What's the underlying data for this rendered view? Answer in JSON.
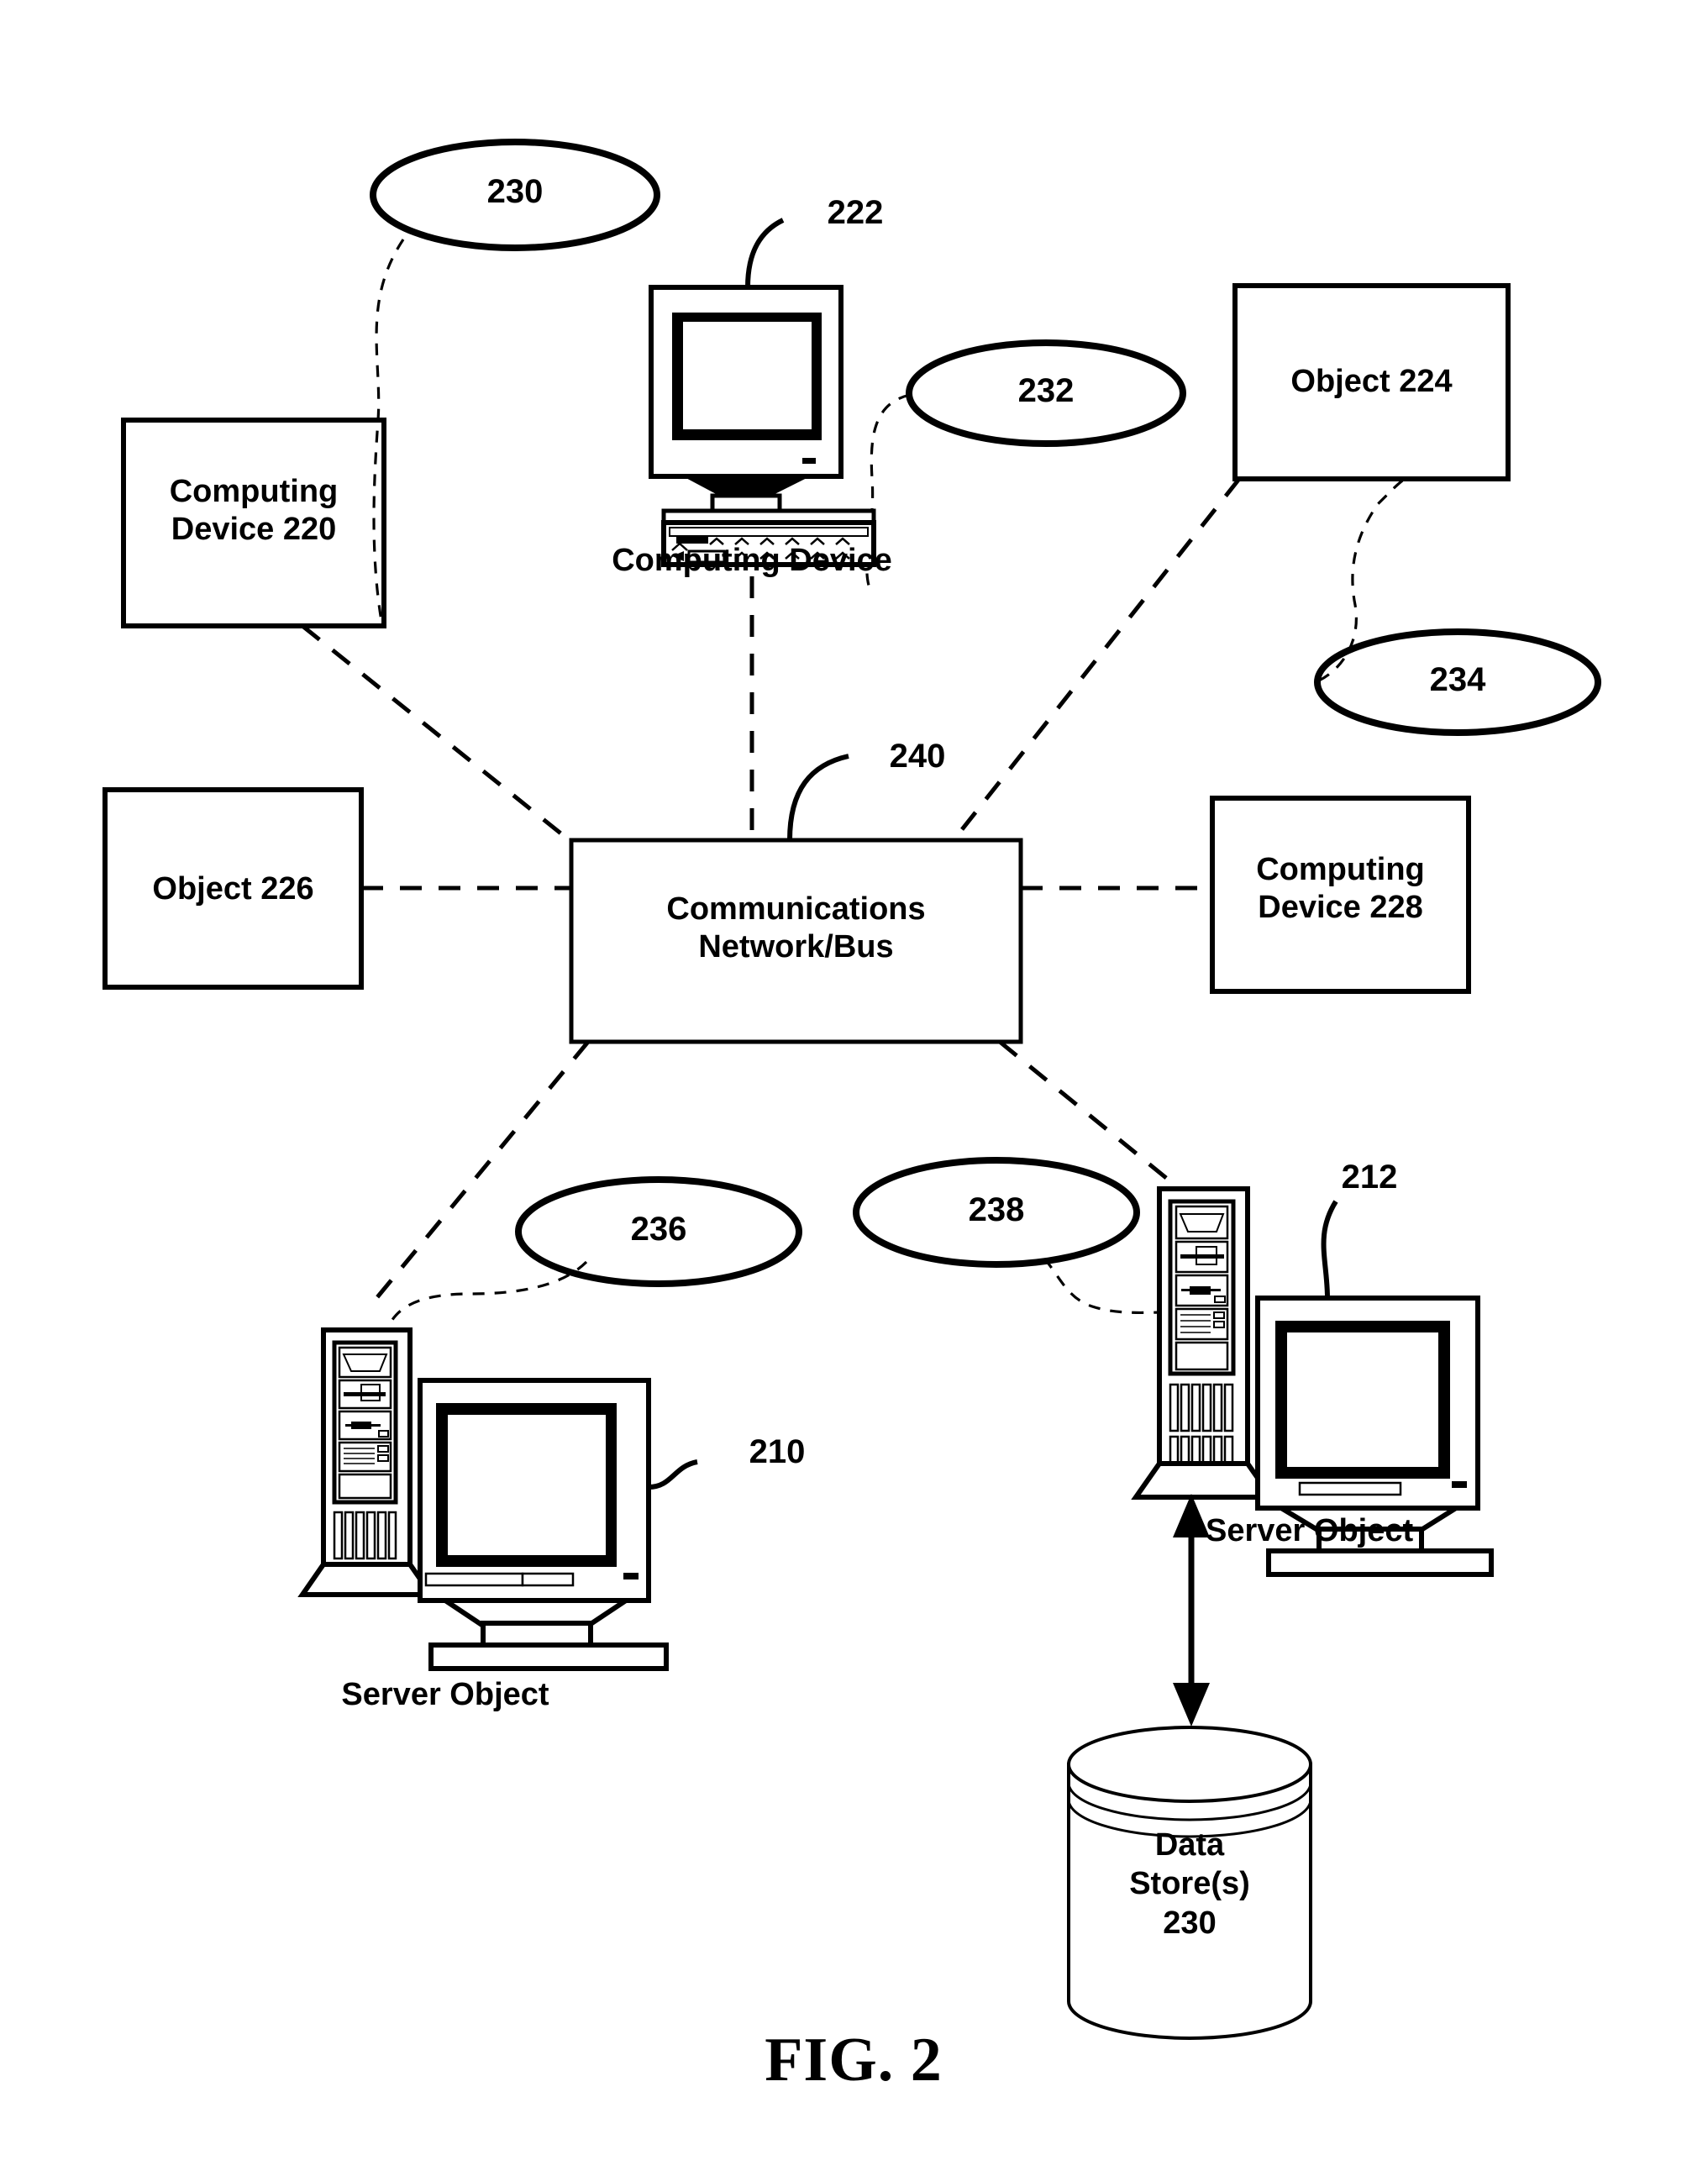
{
  "figure": {
    "caption": "FIG. 2",
    "type": "patent-network-diagram"
  },
  "nodes": {
    "computing_device_220": {
      "label": "Computing\nDevice 220"
    },
    "computing_device_222": {
      "label": "Computing Device",
      "ref": "222"
    },
    "object_224": {
      "label": "Object 224"
    },
    "object_226": {
      "label": "Object 226"
    },
    "computing_device_228": {
      "label": "Computing\nDevice 228"
    },
    "network_bus": {
      "label": "Communications\nNetwork/Bus",
      "ref": "240"
    },
    "server_object_left": {
      "label": "Server Object",
      "ref": "210"
    },
    "server_object_right": {
      "label": "Server Object",
      "ref": "212"
    },
    "data_store": {
      "label": "Data\nStore(s)\n230"
    }
  },
  "callouts": {
    "c230": "230",
    "c232": "232",
    "c234": "234",
    "c236": "236",
    "c238": "238"
  },
  "refs": {
    "r222": "222",
    "r240": "240",
    "r210": "210",
    "r212": "212"
  },
  "colors": {
    "stroke": "#000000",
    "fill": "#ffffff",
    "text": "#000000"
  }
}
